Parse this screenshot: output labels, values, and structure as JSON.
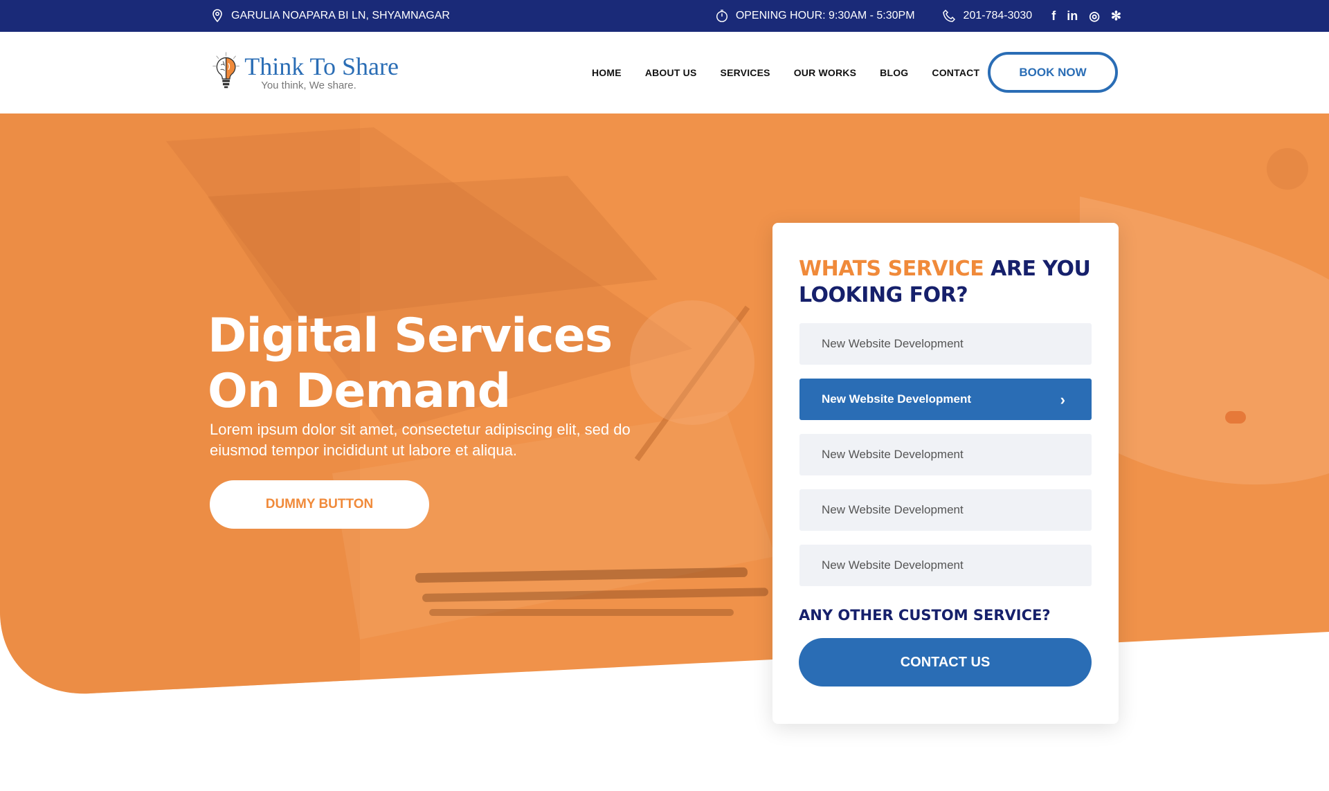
{
  "topbar": {
    "address": "GARULIA NOAPARA BI LN,  SHYAMNAGAR",
    "hours": "OPENING HOUR: 9:30AM - 5:30PM",
    "phone": "201-784-3030",
    "social": [
      {
        "icon": "facebook-icon",
        "glyph": "f"
      },
      {
        "icon": "linkedin-icon",
        "glyph": "in"
      },
      {
        "icon": "instagram-icon",
        "glyph": "◎"
      },
      {
        "icon": "yelp-icon",
        "glyph": "✻"
      }
    ]
  },
  "header": {
    "logo_brand": "Think To Share",
    "logo_tagline": "You think, We share.",
    "nav": [
      "HOME",
      "ABOUT US",
      "SERVICES",
      "OUR WORKS",
      "BLOG",
      "CONTACT"
    ],
    "book_label": "BOOK NOW"
  },
  "hero": {
    "title_line1": "Digital Services",
    "title_line2": "On Demand",
    "subtitle": "Lorem ipsum dolor sit amet, consectetur adipiscing elit, sed do eiusmod tempor incididunt ut labore et aliqua.",
    "button_label": "DUMMY BUTTON"
  },
  "card": {
    "title_highlight": "WHATS SERVICE",
    "title_rest": " ARE YOU LOOKING FOR?",
    "options": [
      "New Website Development",
      "New Website Development",
      "New Website Development",
      "New Website Development",
      "New Website Development"
    ],
    "active_index": 1,
    "other_label": "ANY OTHER CUSTOM SERVICE?",
    "contact_label": "CONTACT US"
  },
  "colors": {
    "navy": "#1a2a78",
    "brand_blue": "#2a6db5",
    "accent_orange": "#f08a3a",
    "hero_orange": "#f0924a"
  }
}
